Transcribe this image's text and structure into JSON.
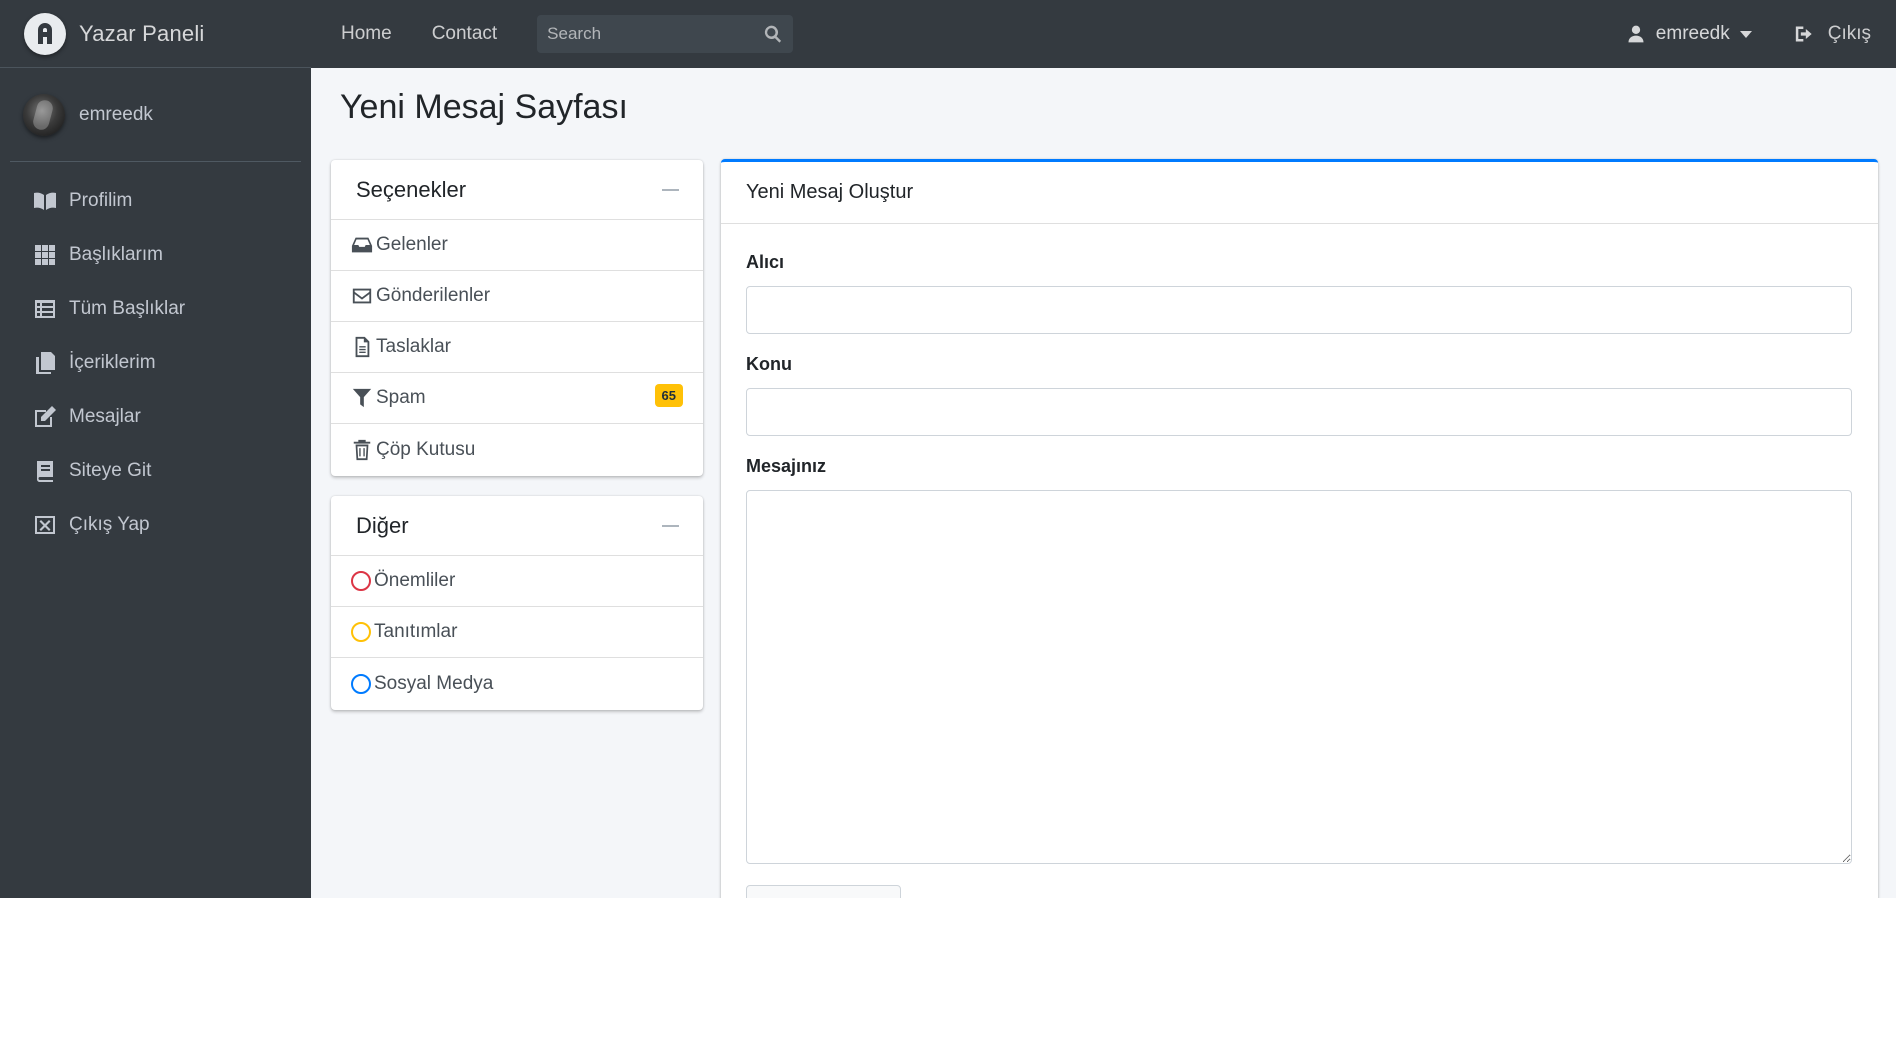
{
  "brand": {
    "title": "Yazar Paneli",
    "logo_icon": "logo-icon"
  },
  "user": {
    "name": "emreedk"
  },
  "sidebar": {
    "items": [
      {
        "label": "Profilim",
        "icon": "book-open-icon"
      },
      {
        "label": "Başlıklarım",
        "icon": "grid-icon"
      },
      {
        "label": "Tüm Başlıklar",
        "icon": "list-icon"
      },
      {
        "label": "İçeriklerim",
        "icon": "copy-icon"
      },
      {
        "label": "Mesajlar",
        "icon": "edit-icon"
      },
      {
        "label": "Siteye Git",
        "icon": "book-icon"
      },
      {
        "label": "Çıkış Yap",
        "icon": "window-close-icon"
      }
    ]
  },
  "topbar": {
    "home": "Home",
    "contact": "Contact",
    "search_placeholder": "Search",
    "user": "emreedk",
    "logout": "Çıkış"
  },
  "page": {
    "title": "Yeni Mesaj Sayfası"
  },
  "options_card": {
    "title": "Seçenekler",
    "items": [
      {
        "label": "Gelenler",
        "icon": "inbox-icon"
      },
      {
        "label": "Gönderilenler",
        "icon": "envelope-icon"
      },
      {
        "label": "Taslaklar",
        "icon": "file-icon"
      },
      {
        "label": "Spam",
        "icon": "filter-icon",
        "badge": "65"
      },
      {
        "label": "Çöp Kutusu",
        "icon": "trash-icon"
      }
    ]
  },
  "other_card": {
    "title": "Diğer",
    "items": [
      {
        "label": "Önemliler",
        "color": "#dc3545"
      },
      {
        "label": "Tanıtımlar",
        "color": "#ffc107"
      },
      {
        "label": "Sosyal Medya",
        "color": "#007bff"
      }
    ]
  },
  "compose": {
    "title": "Yeni Mesaj Oluştur",
    "recipient_label": "Alıcı",
    "recipient_value": "",
    "subject_label": "Konu",
    "subject_value": "",
    "message_label": "Mesajınız",
    "message_value": ""
  },
  "colors": {
    "sidebar_bg": "#343a40",
    "accent": "#007bff",
    "badge": "#ffc107"
  }
}
